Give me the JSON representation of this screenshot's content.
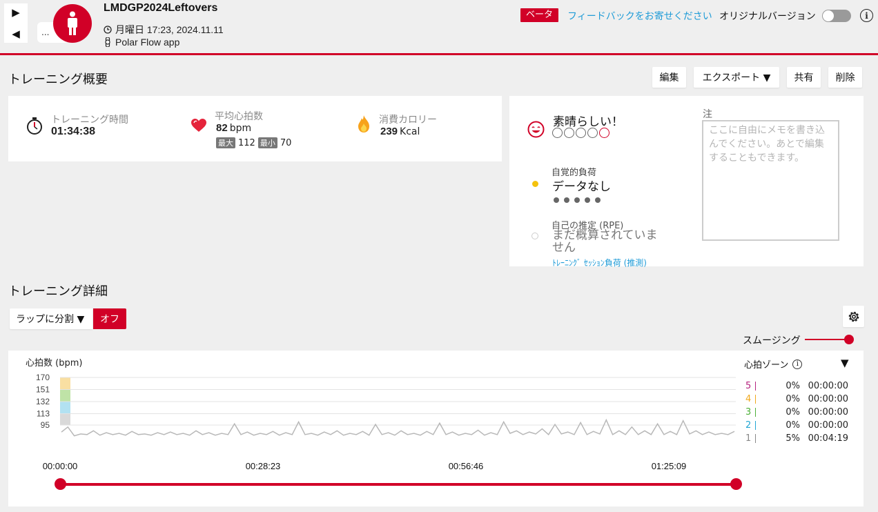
{
  "header": {
    "title": "LMDGP2024Leftovers",
    "datetime": "月曜日 17:23, 2024.11.11",
    "source": "Polar Flow app",
    "more_label": "...",
    "beta_label": "ベータ",
    "feedback_label": "フィードバックをお寄せください",
    "original_version_label": "オリジナルバージョン",
    "accent_color": "#d10027",
    "link_color": "#1e9bd7"
  },
  "overview": {
    "heading": "トレーニング概要",
    "buttons": {
      "edit": "編集",
      "export": "エクスポート ▼",
      "share": "共有",
      "delete": "削除"
    },
    "duration_label": "トレーニング時間",
    "duration_value": "01:34:38",
    "hr_label": "平均心拍数",
    "hr_value": "82",
    "hr_unit": "bpm",
    "hr_max_label": "最大",
    "hr_max_value": "112",
    "hr_min_label": "最小",
    "hr_min_value": "70",
    "calories_label": "消費カロリー",
    "calories_value": "239",
    "calories_unit": "Kcal"
  },
  "feeling": {
    "label": "素晴らしい！",
    "perceived_load_label": "自覚的負荷",
    "perceived_load_value": "データなし",
    "rpe_label": "自己の推定 (RPE)",
    "rpe_value": "まだ概算されていません",
    "session_load_link": "ﾄﾚｰﾆﾝｸﾞ ｾｯｼｮﾝ負荷 (推測)",
    "notes_label": "注",
    "notes_placeholder": "ここに自由にメモを書き込んでください。あとで編集することもできます。"
  },
  "details": {
    "heading": "トレーニング詳細",
    "lap_split_label": "ラップに分割 ▼",
    "lap_off_label": "オフ",
    "smoothing_label": "スムージング"
  },
  "chart_data": {
    "type": "line",
    "ylabel": "心拍数 (bpm)",
    "y_ticks": [
      170,
      151,
      132,
      113,
      95
    ],
    "ylim": [
      77,
      180
    ],
    "x_ticks": [
      "00:00:00",
      "00:28:23",
      "00:56:46",
      "01:25:09"
    ],
    "x_range_minutes": [
      0,
      94.6
    ],
    "series": [
      {
        "values": [
          84,
          92,
          78,
          81,
          80,
          86,
          79,
          83,
          80,
          82,
          79,
          85,
          80,
          81,
          79,
          83,
          80,
          84,
          80,
          82,
          79,
          86,
          80,
          83,
          79,
          82,
          80,
          97,
          80,
          84,
          79,
          82,
          80,
          85,
          79,
          83,
          80,
          100,
          80,
          82,
          79,
          84,
          80,
          86,
          79,
          82,
          80,
          85,
          79,
          96,
          80,
          83,
          79,
          86,
          80,
          82,
          79,
          85,
          80,
          98,
          80,
          84,
          79,
          82,
          80,
          87,
          79,
          83,
          80,
          100,
          82,
          86,
          80,
          84,
          81,
          89,
          80,
          96,
          81,
          84,
          80,
          99,
          80,
          85,
          81,
          103,
          80,
          86,
          80,
          92,
          80,
          86,
          80,
          97,
          80,
          85,
          80,
          102,
          81,
          86,
          80,
          84,
          80,
          82,
          80,
          85
        ],
        "color": "#b8b8b8"
      }
    ],
    "hr_zones": {
      "title": "心拍ゾーン",
      "rows": [
        {
          "zone": "5",
          "percent": "0%",
          "time": "00:00:00",
          "color": "#b5227e"
        },
        {
          "zone": "4",
          "percent": "0%",
          "time": "00:00:00",
          "color": "#f0a81c"
        },
        {
          "zone": "3",
          "percent": "0%",
          "time": "00:00:00",
          "color": "#4caf37"
        },
        {
          "zone": "2",
          "percent": "0%",
          "time": "00:00:00",
          "color": "#21a6d3"
        },
        {
          "zone": "1",
          "percent": "5%",
          "time": "00:04:19",
          "color": "#888888"
        }
      ],
      "band_colors": [
        "#f9dfa2",
        "#bfe3a7",
        "#b2e1f1",
        "#d9d9d9"
      ]
    }
  }
}
